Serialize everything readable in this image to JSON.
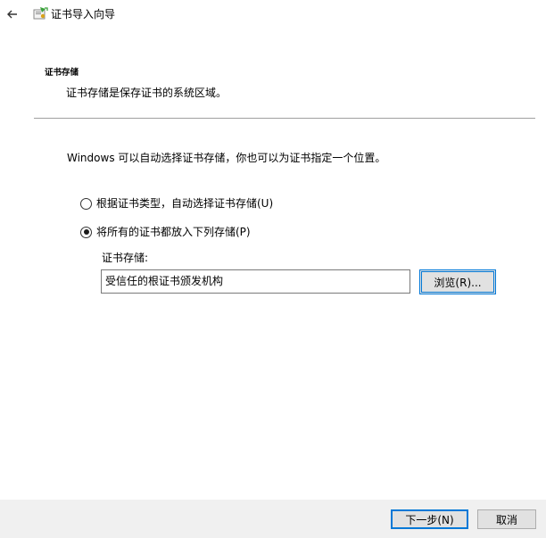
{
  "window": {
    "title": "证书导入向导",
    "back_icon": "back-arrow-icon",
    "app_icon": "certificate-wizard-icon"
  },
  "header": {
    "section_title": "证书存储",
    "section_description": "证书存储是保存证书的系统区域。"
  },
  "body": {
    "intro": "Windows 可以自动选择证书存储，你也可以为证书指定一个位置。",
    "options": [
      {
        "label": "根据证书类型，自动选择证书存储(U)",
        "selected": false
      },
      {
        "label": "将所有的证书都放入下列存储(P)",
        "selected": true
      }
    ],
    "store_label": "证书存储:",
    "store_value": "受信任的根证书颁发机构",
    "browse_label": "浏览(R)..."
  },
  "footer": {
    "next_label": "下一步(N)",
    "cancel_label": "取消"
  },
  "colors": {
    "accent": "#0078d7",
    "footer_bg": "#f0f0f0",
    "button_bg": "#e1e1e1"
  }
}
